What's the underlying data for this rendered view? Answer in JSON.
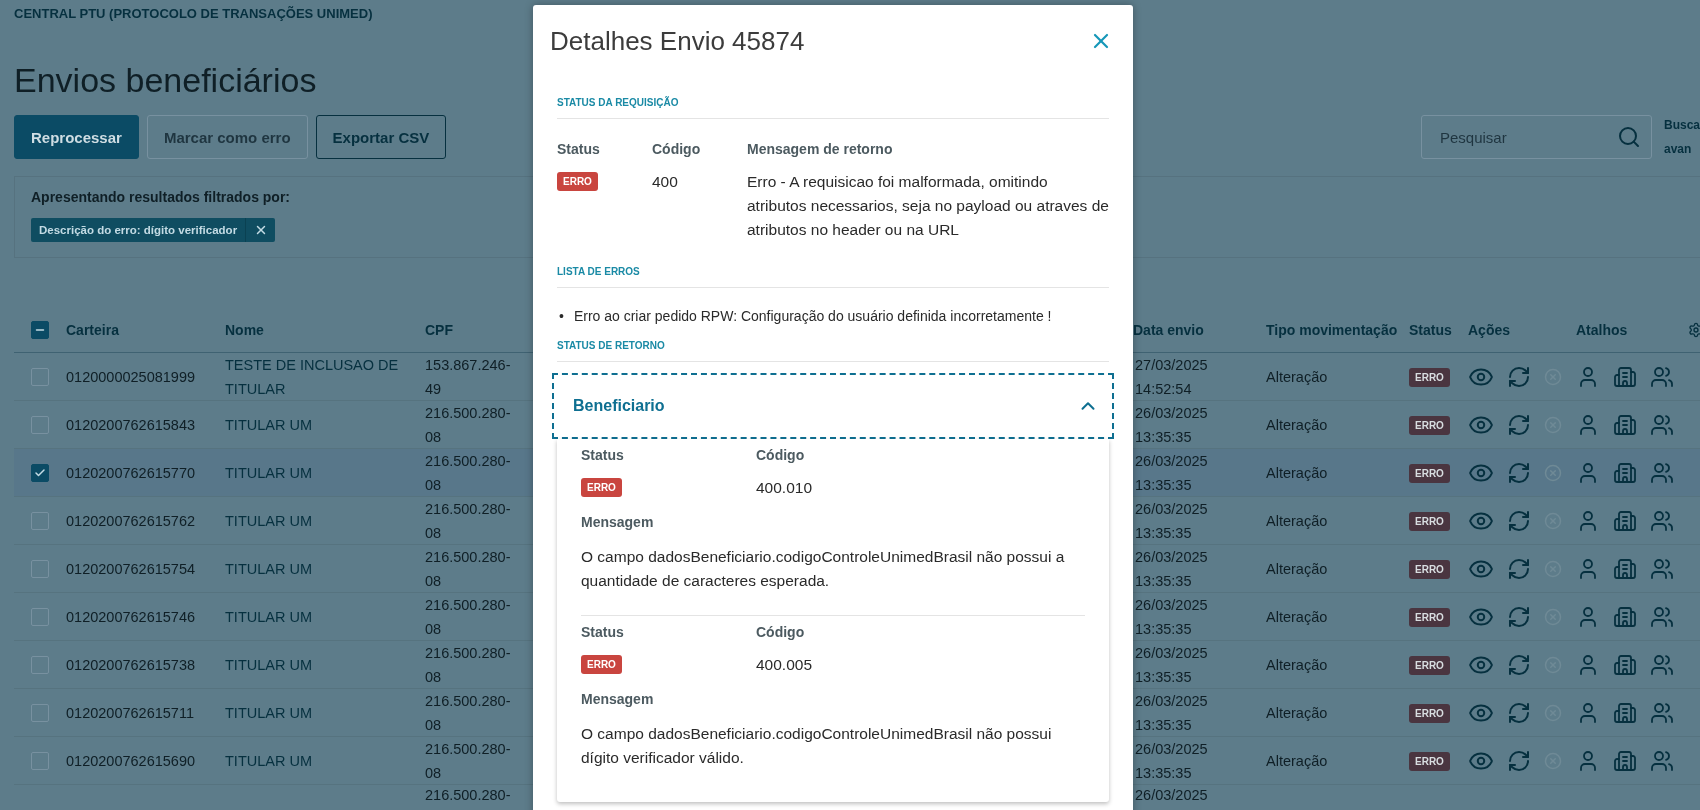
{
  "app_header": {
    "title": "CENTRAL PTU (PROTOCOLO DE TRANSAÇÕES UNIMED)"
  },
  "page": {
    "title": "Envios beneficiários"
  },
  "toolbar": {
    "buttons": [
      {
        "label": "Reprocessar",
        "kind": "primary",
        "disabled": false
      },
      {
        "label": "Marcar como erro",
        "kind": "secondary",
        "disabled": true
      },
      {
        "label": "Exportar CSV",
        "kind": "secondary",
        "disabled": false
      }
    ],
    "search": {
      "placeholder": "Pesquisar"
    },
    "advanced_search": "Busca avan"
  },
  "filters": {
    "label": "Apresentando resultados filtrados por:",
    "chips": [
      {
        "label": "Descrição do erro: dígito verificador"
      }
    ]
  },
  "table": {
    "select_all": {
      "indeterminate": true
    },
    "columns": [
      "Carteira",
      "Nome",
      "CPF",
      "Data envio",
      "Tipo movimentação",
      "Status",
      "Ações",
      "Atalhos"
    ],
    "rows": [
      {
        "kind": "full",
        "checked": false,
        "carteira": "0120000025081999",
        "nome": "TESTE DE INCLUSAO DE TITULAR",
        "cpf": "153.867.246-49",
        "data_envio": "27/03/2025 14:52:54",
        "tipo": "Alteração",
        "status": "ERRO",
        "cancel_disabled": true
      },
      {
        "kind": "full",
        "checked": false,
        "carteira": "0120200762615843",
        "nome": "TITULAR UM",
        "cpf": "216.500.280-08",
        "data_envio": "26/03/2025 13:35:35",
        "tipo": "Alteração",
        "status": "ERRO",
        "cancel_disabled": true
      },
      {
        "kind": "full",
        "checked": true,
        "carteira": "0120200762615770",
        "nome": "TITULAR UM",
        "cpf": "216.500.280-08",
        "data_envio": "26/03/2025 13:35:35",
        "tipo": "Alteração",
        "status": "ERRO",
        "cancel_disabled": true
      },
      {
        "kind": "full",
        "checked": false,
        "carteira": "0120200762615762",
        "nome": "TITULAR UM",
        "cpf": "216.500.280-08",
        "data_envio": "26/03/2025 13:35:35",
        "tipo": "Alteração",
        "status": "ERRO",
        "cancel_disabled": true
      },
      {
        "kind": "full",
        "checked": false,
        "carteira": "0120200762615754",
        "nome": "TITULAR UM",
        "cpf": "216.500.280-08",
        "data_envio": "26/03/2025 13:35:35",
        "tipo": "Alteração",
        "status": "ERRO",
        "cancel_disabled": true
      },
      {
        "kind": "full",
        "checked": false,
        "carteira": "0120200762615746",
        "nome": "TITULAR UM",
        "cpf": "216.500.280-08",
        "data_envio": "26/03/2025 13:35:35",
        "tipo": "Alteração",
        "status": "ERRO",
        "cancel_disabled": true
      },
      {
        "kind": "full",
        "checked": false,
        "carteira": "0120200762615738",
        "nome": "TITULAR UM",
        "cpf": "216.500.280-08",
        "data_envio": "26/03/2025 13:35:35",
        "tipo": "Alteração",
        "status": "ERRO",
        "cancel_disabled": true
      },
      {
        "kind": "full",
        "checked": false,
        "carteira": "0120200762615711",
        "nome": "TITULAR UM",
        "cpf": "216.500.280-08",
        "data_envio": "26/03/2025 13:35:35",
        "tipo": "Alteração",
        "status": "ERRO",
        "cancel_disabled": true
      },
      {
        "kind": "full",
        "checked": false,
        "carteira": "0120200762615690",
        "nome": "TITULAR UM",
        "cpf": "216.500.280-08",
        "data_envio": "26/03/2025 13:35:35",
        "tipo": "Alteração",
        "status": "ERRO",
        "cancel_disabled": true
      },
      {
        "kind": "partial",
        "cpf": "216.500.280-",
        "data_envio": "26/03/2025"
      }
    ]
  },
  "modal": {
    "title": "Detalhes Envio 45874",
    "request_status": {
      "label": "STATUS DA REQUISIÇÃO",
      "headings": [
        "Status",
        "Código",
        "Mensagem de retorno"
      ],
      "status": "ERRO",
      "code": "400",
      "message": "Erro - A requisicao foi malformada, omitindo atributos necessarios, seja no payload ou atraves de atributos no header ou na URL"
    },
    "error_list": {
      "label": "LISTA DE ERROS",
      "items": [
        {
          "bullet": "•",
          "text": "Erro ao criar pedido RPW: Configuração do usuário definida incorretamente !"
        }
      ]
    },
    "return_status": {
      "label": "STATUS DE RETORNO",
      "accordion": {
        "title": "Beneficiario",
        "expanded": true,
        "entries": [
          {
            "status_heading": "Status",
            "code_heading": "Código",
            "status": "ERRO",
            "code": "400.010",
            "message_heading": "Mensagem",
            "message": "O campo dadosBeneficiario.codigoControleUnimedBrasil não possui a quantidade de caracteres esperada."
          },
          {
            "status_heading": "Status",
            "code_heading": "Código",
            "status": "ERRO",
            "code": "400.005",
            "message_heading": "Mensagem",
            "message": "O campo dadosBeneficiario.codigoControleUnimedBrasil não possui dígito verificador válido."
          }
        ]
      }
    }
  }
}
